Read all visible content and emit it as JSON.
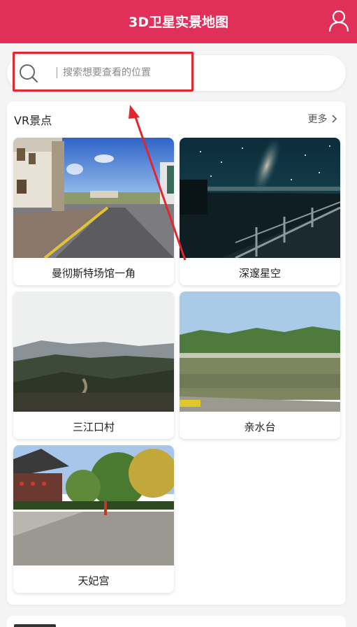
{
  "header": {
    "title": "3D卫星实景地图",
    "user_icon": "user-icon"
  },
  "search": {
    "placeholder": "搜索想要查看的位置",
    "value": ""
  },
  "vr_section": {
    "title": "VR景点",
    "more_label": "更多",
    "items": [
      {
        "label": "曼彻斯特场馆一角"
      },
      {
        "label": "深邃星空"
      },
      {
        "label": "三江口村"
      },
      {
        "label": "亲水台"
      },
      {
        "label": "天妃宫"
      }
    ]
  },
  "colors": {
    "header": "#e0305a",
    "highlight": "#e3262e",
    "background": "#f4f4f4"
  }
}
